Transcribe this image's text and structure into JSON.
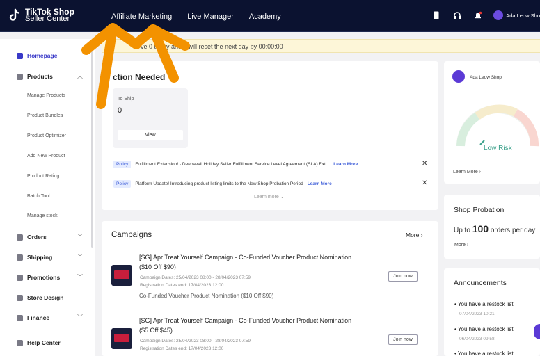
{
  "brand": {
    "line1": "TikTok Shop",
    "line2": "Seller Center"
  },
  "nav": {
    "items": [
      "Affiliate Marketing",
      "Live Manager",
      "Academy"
    ]
  },
  "header": {
    "shop_name": "Ada Leow Sho"
  },
  "notice": {
    "text": "ve 0 today and it will reset the next day by 00:00:00"
  },
  "sidebar": {
    "homepage": "Homepage",
    "products": "Products",
    "product_subitems": [
      "Manage Products",
      "Product Bundles",
      "Product Optimizer",
      "Add New Product",
      "Product Rating",
      "Batch Tool",
      "Manage stock"
    ],
    "orders": "Orders",
    "shipping": "Shipping",
    "promotions": "Promotions",
    "store_design": "Store Design",
    "finance": "Finance",
    "help_center": "Help Center"
  },
  "action": {
    "title": "ction Needed",
    "to_ship_label": "To Ship",
    "to_ship_value": "0",
    "view_label": "View",
    "policy_label": "Policy",
    "policies": [
      {
        "text": "Fulfillment Extension! - Deepavali Holiday Seller Fulfillment Service Level Agreement (SLA) Ext...",
        "link": "Learn More"
      },
      {
        "text": "Platform Update! Introducing product listing limits to the New Shop Probation Period",
        "link": "Learn More"
      }
    ],
    "learn_more_center": "Learn more ⌄"
  },
  "campaigns": {
    "title": "Campaigns",
    "more": "More",
    "items": [
      {
        "title_line1": "[SG] Apr Treat Yourself Campaign - Co-Funded Voucher Product Nomination",
        "title_line2": "($10 Off $90)",
        "campaign_dates": "Campaign Dates: 25/04/2023 08:00 - 28/04/2023 07:59",
        "registration": "Registration Dates end: 17/04/2023 12:00",
        "subtitle": "Co-Funded Voucher Product Nomination ($10 Off $90)",
        "join": "Join now"
      },
      {
        "title_line1": "[SG] Apr Treat Yourself Campaign - Co-Funded Voucher Product Nomination",
        "title_line2": "($5 Off $45)",
        "campaign_dates": "Campaign Dates: 25/04/2023 08:00 - 28/04/2023 07:59",
        "registration": "Registration Dates end: 17/04/2023 12:00",
        "join": "Join now"
      }
    ]
  },
  "right": {
    "shop_name": "Ada Leow Shop",
    "health_status": "Low Risk",
    "learn_more": "Learn More",
    "probation_title": "Shop Probation",
    "probation_prefix": "Up to",
    "probation_number": "100",
    "probation_suffix": "orders per day",
    "probation_more": "More",
    "announcements_title": "Announcements",
    "announcements": [
      {
        "text": "You have a restock list",
        "date": "07/04/2023 10:21"
      },
      {
        "text": "You have a restock list",
        "date": "06/04/2023 09:58"
      },
      {
        "text": "You have a restock list"
      }
    ]
  },
  "colors": {
    "topbar": "#0b1230",
    "accent": "#3b5bd8",
    "arrow": "#f39200",
    "notice_bg": "#fdf6d8",
    "low_risk": "#3aa08a"
  }
}
